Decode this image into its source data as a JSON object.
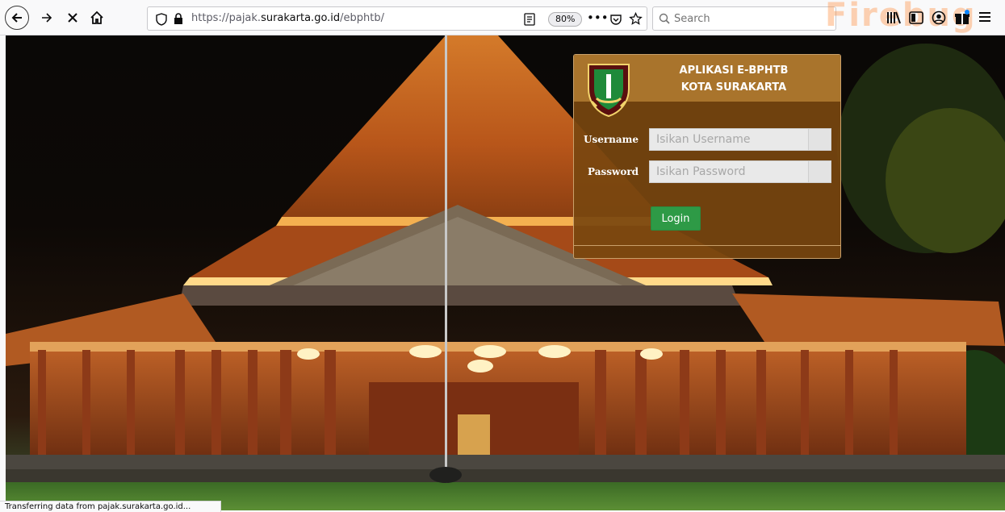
{
  "browser": {
    "url_prefix": "https://pajak.",
    "url_domain": "surakarta.go.id",
    "url_path": "/ebphtb/",
    "zoom": "80%",
    "search_placeholder": "Search",
    "firebug_watermark": "Firebug"
  },
  "login": {
    "title_line1": "APLIKASI E-BPHTB",
    "title_line2": "KOTA SURAKARTA",
    "username_label": "Username",
    "username_placeholder": "Isikan Username",
    "password_label": "Password",
    "password_placeholder": "Isikan Password",
    "login_button": "Login"
  },
  "status": {
    "text": "Transferring data from pajak.surakarta.go.id..."
  }
}
